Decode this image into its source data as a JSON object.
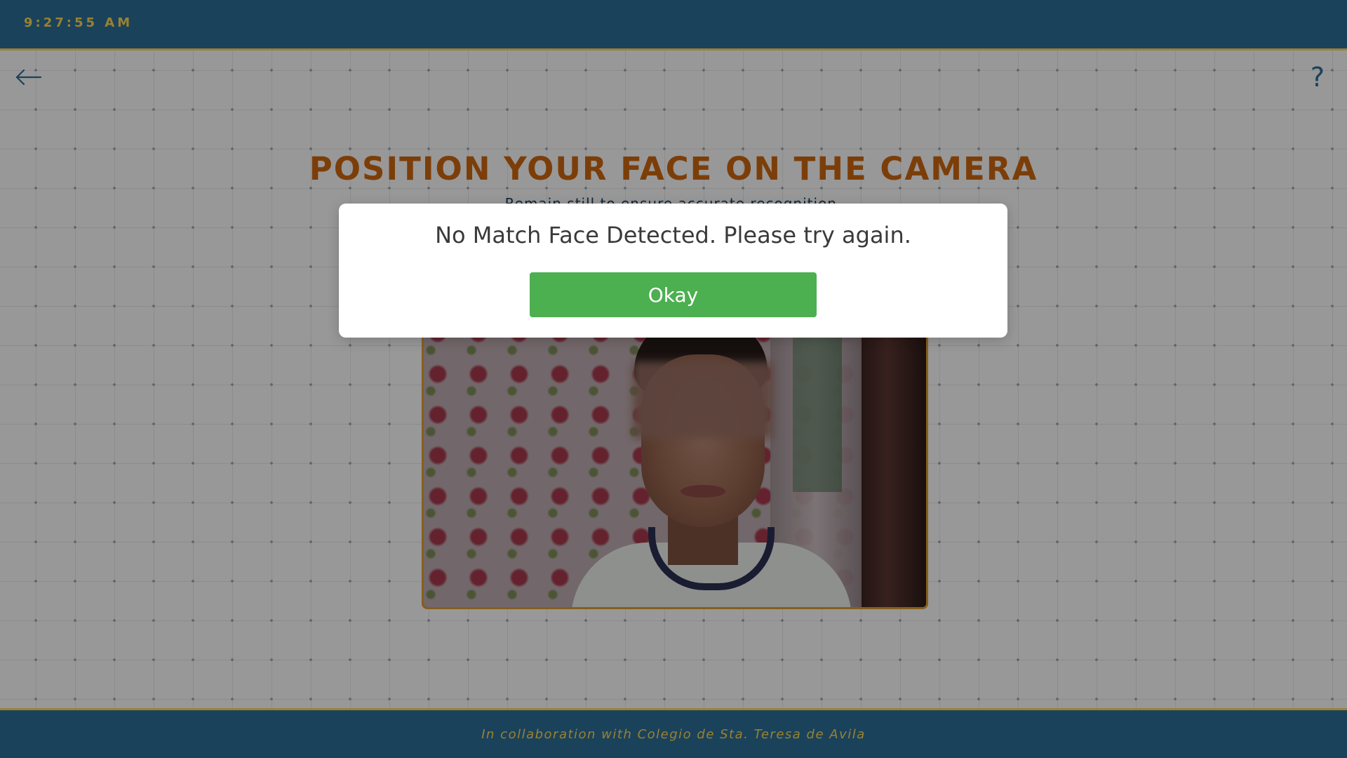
{
  "header": {
    "clock": "9:27:55 AM"
  },
  "nav": {
    "back_icon": "arrow-left-icon",
    "help_label": "?"
  },
  "main": {
    "title": "POSITION YOUR FACE ON THE CAMERA",
    "subtitle": "Remain still to ensure accurate recognition."
  },
  "dialog": {
    "message": "No Match Face Detected. Please try again.",
    "okay_label": "Okay"
  },
  "footer": {
    "text": "In collaboration with Colegio de Sta. Teresa de Avila"
  },
  "colors": {
    "primary": "#2d6b94",
    "accent": "#f6d24f",
    "title": "#c8650f",
    "success": "#4caf50"
  }
}
